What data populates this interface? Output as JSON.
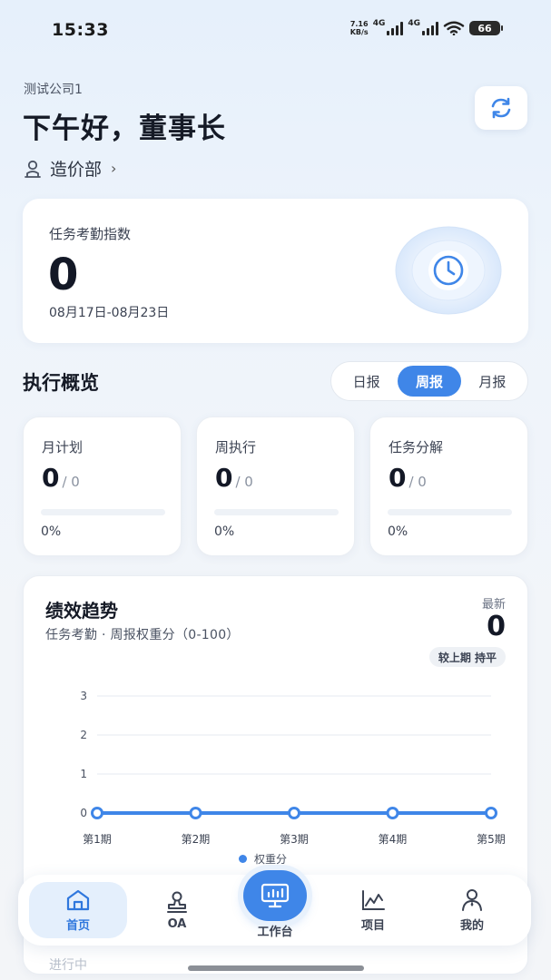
{
  "status_bar": {
    "time": "15:33",
    "net_speed_value": "7.16",
    "net_speed_unit": "KB/s",
    "signal1_label": "4G",
    "signal2_label": "4G",
    "battery": "66"
  },
  "header": {
    "company": "测试公司1",
    "greeting": "下午好，董事长",
    "department": "造价部",
    "department_chevron": "›"
  },
  "attendance": {
    "title": "任务考勤指数",
    "value": "0",
    "range": "08月17日-08月23日"
  },
  "execution": {
    "title": "执行概览",
    "tabs": [
      {
        "label": "日报",
        "active": false
      },
      {
        "label": "周报",
        "active": true
      },
      {
        "label": "月报",
        "active": false
      }
    ],
    "stats": [
      {
        "label": "月计划",
        "value": "0",
        "total": "/ 0",
        "percent": "0%",
        "progress": 0
      },
      {
        "label": "周执行",
        "value": "0",
        "total": "/ 0",
        "percent": "0%",
        "progress": 0
      },
      {
        "label": "任务分解",
        "value": "0",
        "total": "/ 0",
        "percent": "0%",
        "progress": 0
      }
    ]
  },
  "performance": {
    "title": "绩效趋势",
    "subtitle": "任务考勤 · 周报权重分（0-100）",
    "latest_label": "最新",
    "latest_value": "0",
    "compare": "较上期 持平",
    "peek_text": "进行中"
  },
  "chart_data": {
    "type": "line",
    "categories": [
      "第1期",
      "第2期",
      "第3期",
      "第4期",
      "第5期"
    ],
    "series": [
      {
        "name": "权重分",
        "values": [
          0,
          0,
          0,
          0,
          0
        ]
      }
    ],
    "yticks": [
      "0",
      "1",
      "2",
      "3"
    ],
    "ylim": [
      0,
      3
    ],
    "grid": true,
    "legend": "bottom",
    "color": "#3f86e8"
  },
  "tabbar": {
    "items": [
      {
        "label": "首页",
        "icon": "home-icon",
        "active": true
      },
      {
        "label": "OA",
        "icon": "stamp-icon",
        "active": false
      },
      {
        "label": "工作台",
        "icon": "monitor-chart-icon",
        "active": false
      },
      {
        "label": "项目",
        "icon": "line-chart-icon",
        "active": false
      },
      {
        "label": "我的",
        "icon": "user-icon",
        "active": false
      }
    ]
  },
  "colors": {
    "accent": "#3f86e8",
    "text_primary": "#151a26",
    "text_secondary": "#3b4252"
  }
}
